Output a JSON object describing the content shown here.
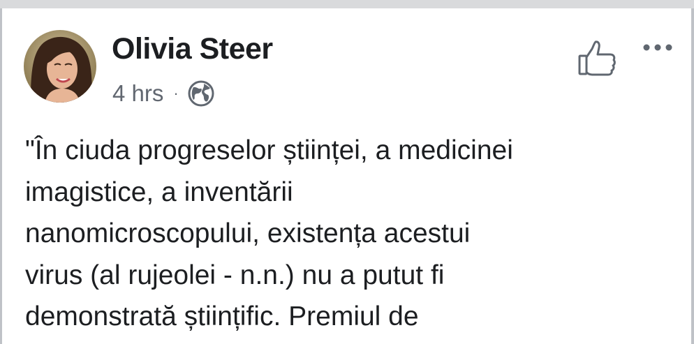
{
  "post": {
    "author": "Olivia Steer",
    "time": "4 hrs",
    "separator": "·",
    "privacy_icon": "globe-icon",
    "like_icon": "thumbs-up-icon",
    "more_icon": "more-options-icon",
    "text_lines": [
      "\"În ciuda progreselor științei, a medicinei",
      "imagistice, a inventării",
      "nanomicroscopului, existența acestui",
      "virus (al rujeolei - n.n.) nu a putut fi",
      "demonstrată științific. Premiul de"
    ]
  },
  "colors": {
    "text": "#1c1e21",
    "meta": "#616770",
    "icon": "#606770",
    "top_bar": "#d9dadc"
  }
}
